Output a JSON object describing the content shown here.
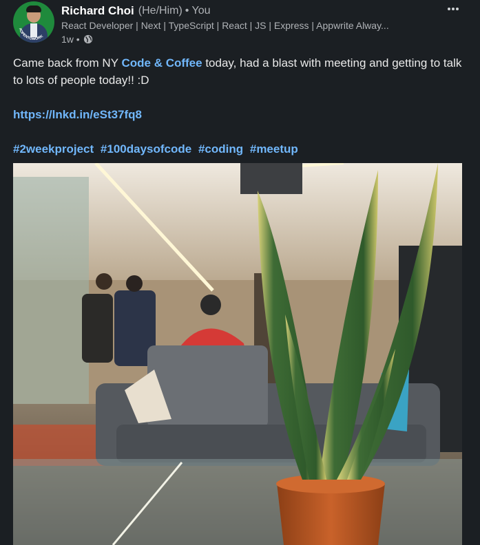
{
  "author": {
    "name": "Richard Choi",
    "pronouns": "(He/Him)",
    "relation": "• You",
    "headline": "React Developer | Next | TypeScript | React | JS | Express | Appwrite Alway...",
    "time": "1w •",
    "avatar_badge": "#OPENTOWORK"
  },
  "post": {
    "text_before": "Came back from NY ",
    "mention": "Code & Coffee",
    "text_after": " today, had a blast with meeting and getting to talk to lots of people today!! :D",
    "link": "https://lnkd.in/eSt37fq8",
    "hashtags": [
      "#2weekproject",
      "#100daysofcode",
      "#coding",
      "#meetup"
    ]
  },
  "icons": {
    "more": "more-options-icon",
    "visibility": "globe-icon"
  },
  "colors": {
    "background": "#1b1f23",
    "link": "#71b7fb",
    "badge": "#1f8a3c"
  }
}
